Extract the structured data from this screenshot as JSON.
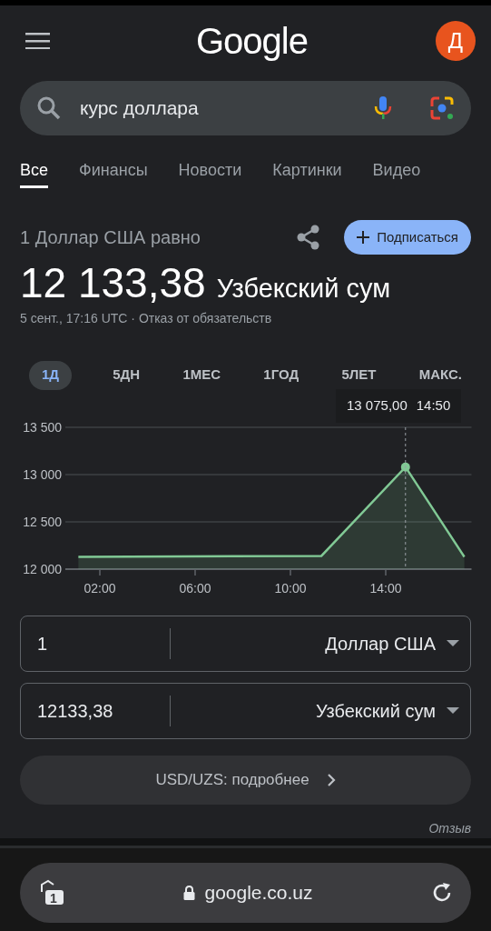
{
  "header": {
    "logo": "Google",
    "avatar_letter": "Д"
  },
  "search": {
    "value": "курс доллара"
  },
  "tabs": [
    {
      "label": "Все",
      "selected": true
    },
    {
      "label": "Финансы",
      "selected": false
    },
    {
      "label": "Новости",
      "selected": false
    },
    {
      "label": "Картинки",
      "selected": false
    },
    {
      "label": "Видео",
      "selected": false
    }
  ],
  "currency": {
    "heading": "1 Доллар США равно",
    "subscribe": "Подписаться",
    "amount": "12 133,38",
    "unit": "Узбекский сум",
    "timestamp": "5 сент., 17:16 UTC ·",
    "disclaimer": "Отказ от обязательств"
  },
  "ranges": [
    {
      "label": "1Д",
      "selected": true
    },
    {
      "label": "5ДН",
      "selected": false
    },
    {
      "label": "1МЕС",
      "selected": false
    },
    {
      "label": "1ГОД",
      "selected": false
    },
    {
      "label": "5ЛЕТ",
      "selected": false
    },
    {
      "label": "МАКС.",
      "selected": false
    }
  ],
  "tooltip": {
    "value": "13 075,00",
    "time": "14:50"
  },
  "chart_data": {
    "type": "area",
    "x": [
      1.1,
      11.3,
      14.83,
      17.3
    ],
    "series": [
      {
        "color": "#81c995",
        "values": [
          12130,
          12140,
          13080,
          12130
        ]
      }
    ],
    "xlim": [
      0.55,
      17.6
    ],
    "ref_lines": [
      {
        "axis": "x",
        "value": 14.83
      }
    ],
    "ylim": [
      12000,
      13500
    ],
    "yticks": [
      {
        "value": 12000,
        "label": "12 000"
      },
      {
        "value": 12500,
        "label": "12 500"
      },
      {
        "value": 13000,
        "label": "13 000"
      },
      {
        "value": 13500,
        "label": "13 500"
      }
    ],
    "xticks": [
      {
        "value": 2,
        "label": "02:00"
      },
      {
        "value": 6,
        "label": "06:00"
      },
      {
        "value": 10,
        "label": "10:00"
      },
      {
        "value": 14,
        "label": "14:00"
      }
    ]
  },
  "converter": [
    {
      "amount": "1",
      "currency": "Доллар США"
    },
    {
      "amount": "12133,38",
      "currency": "Узбекский сум"
    }
  ],
  "details_link": "USD/UZS: подробнее",
  "feedback": "Отзыв",
  "browser": {
    "url": "google.co.uz",
    "tab_count": "1"
  }
}
